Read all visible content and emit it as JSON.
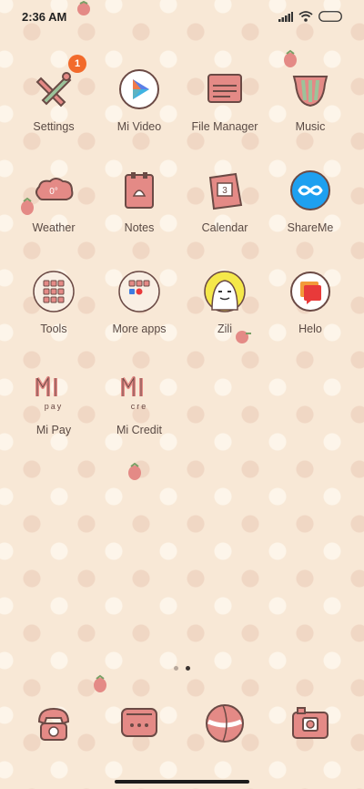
{
  "status_bar": {
    "time": "2:36 AM",
    "signal_icon": "cellular-signal-icon",
    "wifi_icon": "wifi-icon",
    "battery_icon": "battery-icon"
  },
  "apps": [
    {
      "label": "Settings",
      "icon": "settings-icon",
      "badge": "1"
    },
    {
      "label": "Mi Video",
      "icon": "mi-video-icon"
    },
    {
      "label": "File Manager",
      "icon": "file-manager-icon"
    },
    {
      "label": "Music",
      "icon": "music-icon"
    },
    {
      "label": "Weather",
      "icon": "weather-icon",
      "icon_text": "0°"
    },
    {
      "label": "Notes",
      "icon": "notes-icon"
    },
    {
      "label": "Calendar",
      "icon": "calendar-icon",
      "icon_text": "3"
    },
    {
      "label": "ShareMe",
      "icon": "shareme-icon"
    },
    {
      "label": "Tools",
      "icon": "tools-folder-icon"
    },
    {
      "label": "More apps",
      "icon": "more-apps-folder-icon"
    },
    {
      "label": "Zili",
      "icon": "zili-icon"
    },
    {
      "label": "Helo",
      "icon": "helo-icon"
    },
    {
      "label": "Mi Pay",
      "icon": "mi-pay-icon",
      "icon_text": "pay"
    },
    {
      "label": "Mi Credit",
      "icon": "mi-credit-icon",
      "icon_text": "cre"
    }
  ],
  "page_indicator": {
    "pages": 2,
    "current": 2
  },
  "dock": [
    {
      "icon": "phone-icon"
    },
    {
      "icon": "messages-icon"
    },
    {
      "icon": "browser-icon"
    },
    {
      "icon": "camera-icon"
    }
  ],
  "colors": {
    "wallpaper": "#f8e8d6",
    "icon_pink": "#e07b78",
    "icon_outline": "#6b4a45",
    "badge": "#f26a2b",
    "label_text": "#5a4a44"
  }
}
